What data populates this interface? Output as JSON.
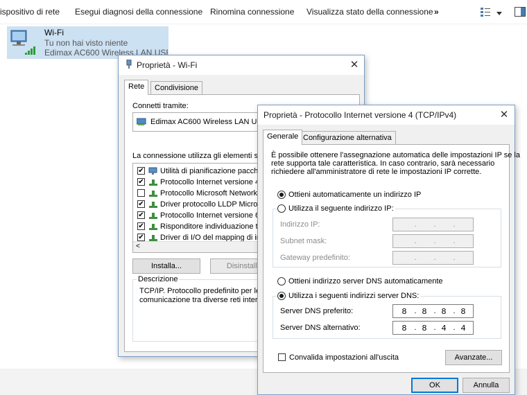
{
  "toolbar": {
    "items": [
      "ispositivo di rete",
      "Esegui diagnosi della connessione",
      "Rinomina connessione",
      "Visualizza stato della connessione",
      "»"
    ],
    "view_icon": "view-options-icon",
    "dropdown_icon": "chevron-down-icon",
    "pane_icon": "preview-pane-icon"
  },
  "adapter": {
    "name": "Wi-Fi",
    "status": "Tu non hai visto niente",
    "device": "Edimax AC600 Wireless LAN USB ...",
    "icon": "wifi-adapter-icon"
  },
  "wifi_props": {
    "title": "Proprietà - Wi-Fi",
    "tabs": [
      "Rete",
      "Condivisione"
    ],
    "connect_label": "Connetti tramite:",
    "connect_device": "Edimax AC600 Wireless LAN USB",
    "items_label": "La connessione utilizza gli elementi segue",
    "items": [
      {
        "label": "Utilità di pianificazione pacchetti",
        "checked": true
      },
      {
        "label": "Protocollo Internet versione 4 (T",
        "checked": true
      },
      {
        "label": "Protocollo Microsoft Network Ad",
        "checked": false
      },
      {
        "label": "Driver protocollo LLDP Microsoft",
        "checked": true
      },
      {
        "label": "Protocollo Internet versione 6 (T",
        "checked": true
      },
      {
        "label": "Risponditore individuazione topo",
        "checked": true
      },
      {
        "label": "Driver di I/O del mapping di indiv",
        "checked": true
      }
    ],
    "install_btn": "Installa...",
    "uninstall_btn": "Disinstalla",
    "desc_label": "Descrizione",
    "desc_line1": "TCP/IP. Protocollo predefinito per le W",
    "desc_line2": "comunicazione tra diverse reti intercon"
  },
  "ipv4": {
    "title": "Proprietà - Protocollo Internet versione 4 (TCP/IPv4)",
    "tabs": [
      "Generale",
      "Configurazione alternativa"
    ],
    "intro1": "È possibile ottenere l'assegnazione automatica delle impostazioni IP se la",
    "intro2": "rete supporta tale caratteristica. In caso contrario, sarà necessario",
    "intro3": "richiedere all'amministratore di rete le impostazioni IP corrette.",
    "auto_ip": "Ottieni automaticamente un indirizzo IP",
    "manual_ip": "Utilizza il seguente indirizzo IP:",
    "ip_label": "Indirizzo IP:",
    "mask_label": "Subnet mask:",
    "gw_label": "Gateway predefinito:",
    "auto_dns": "Ottieni indirizzo server DNS automaticamente",
    "manual_dns": "Utilizza i seguenti indirizzi server DNS:",
    "dns_pref_label": "Server DNS preferito:",
    "dns_pref": [
      "8",
      "8",
      "8",
      "8"
    ],
    "dns_alt_label": "Server DNS alternativo:",
    "dns_alt": [
      "8",
      "8",
      "4",
      "4"
    ],
    "validate": "Convalida impostazioni all'uscita",
    "advanced_btn": "Avanzate...",
    "ok_btn": "OK",
    "cancel_btn": "Annulla"
  }
}
